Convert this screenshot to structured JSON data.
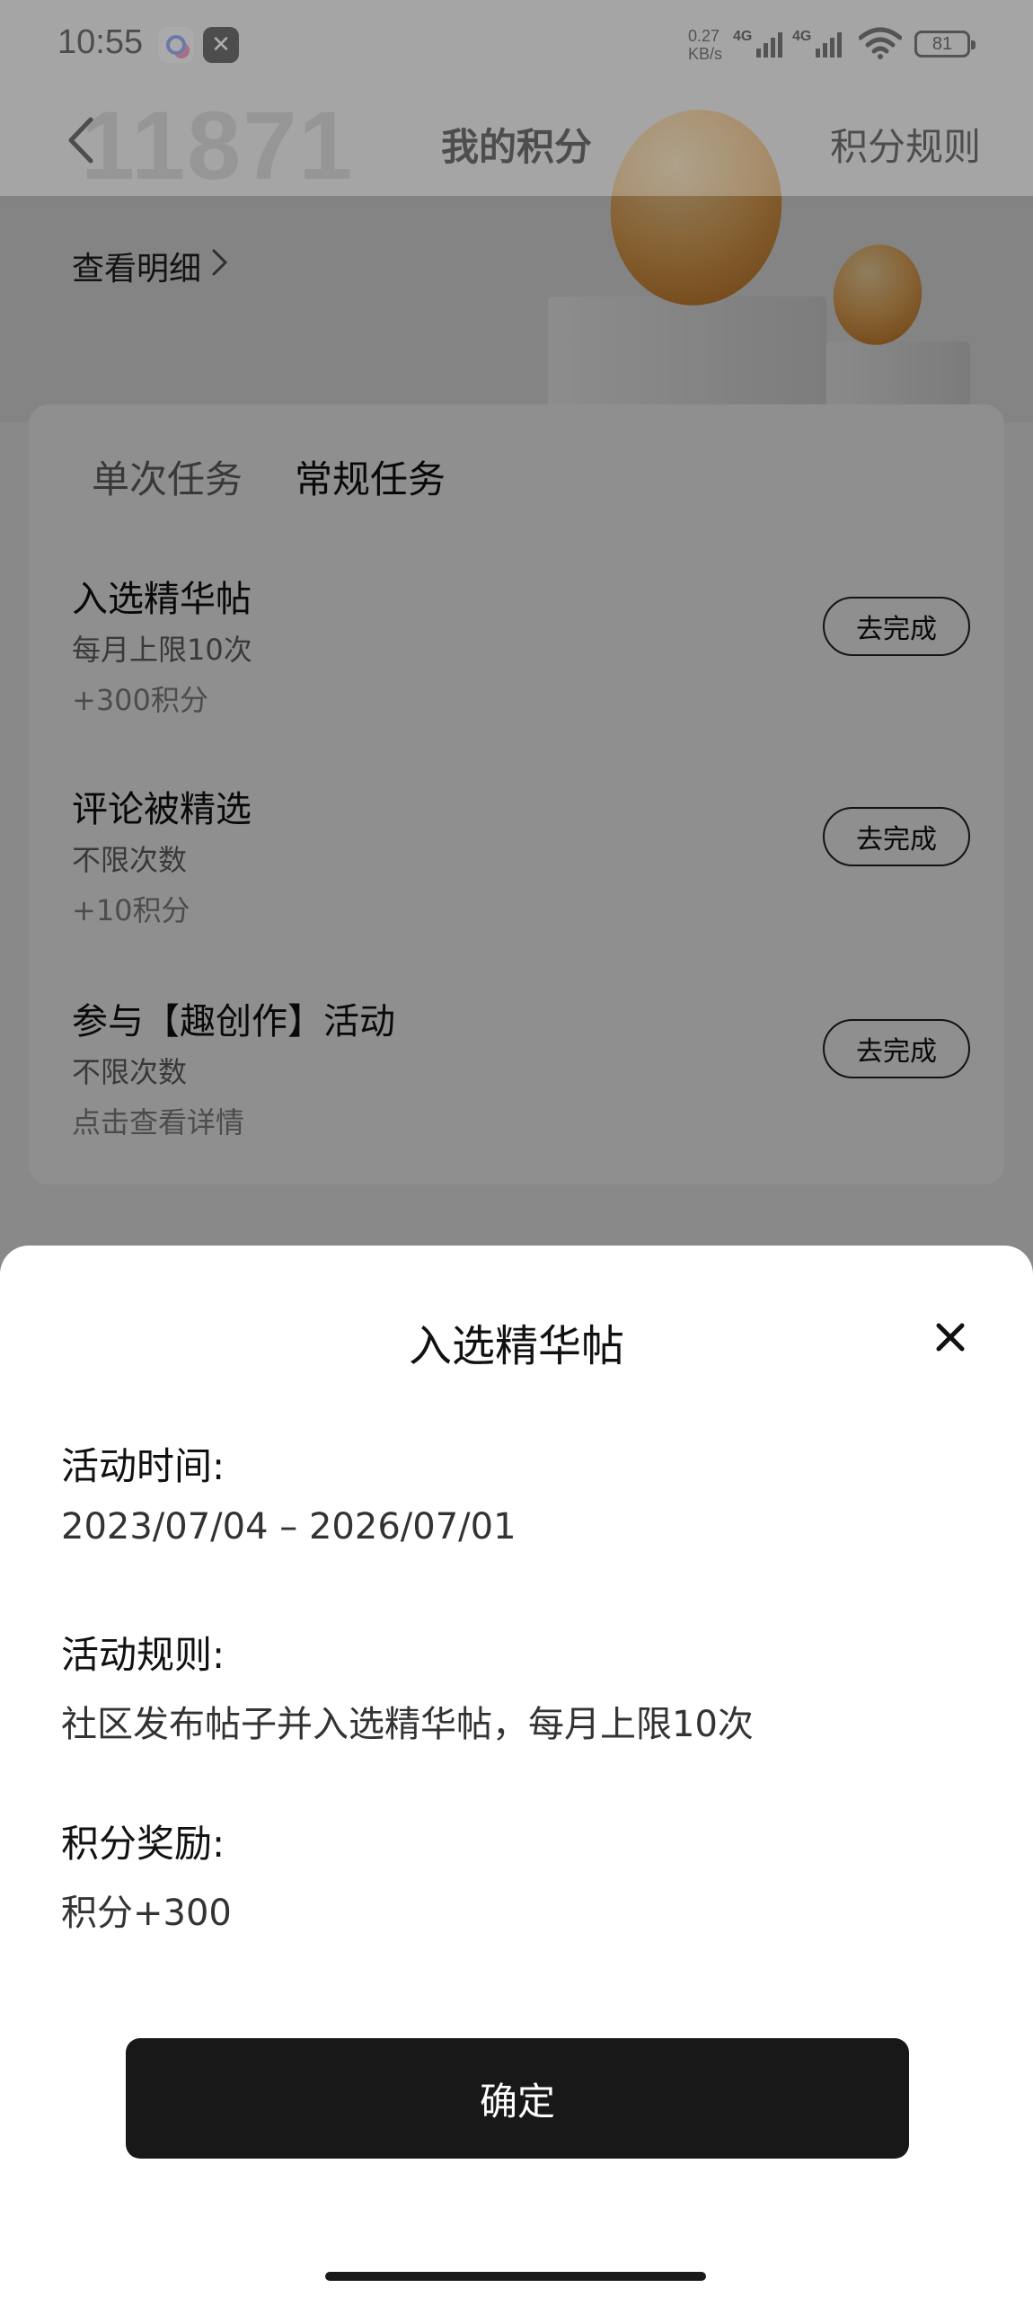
{
  "status_bar": {
    "time": "10:55",
    "net_speed_value": "0.27",
    "net_speed_unit": "KB/s",
    "signal_1_label": "4G",
    "signal_2_label": "4G",
    "battery": "81"
  },
  "nav": {
    "title": "我的积分",
    "rules_label": "积分规则"
  },
  "points": {
    "value": "11871",
    "detail_label": "查看明细"
  },
  "tabs": [
    {
      "label": "单次任务"
    },
    {
      "label": "常规任务"
    }
  ],
  "tasks": [
    {
      "title": "入选精华帖",
      "sub1": "每月上限10次",
      "sub2": "+300积分",
      "button": "去完成"
    },
    {
      "title": "评论被精选",
      "sub1": "不限次数",
      "sub2": "+10积分",
      "button": "去完成"
    },
    {
      "title": "参与【趣创作】活动",
      "sub1": "不限次数",
      "sub2": "点击查看详情",
      "button": "去完成"
    }
  ],
  "sheet": {
    "title": "入选精华帖",
    "time_label": "活动时间:",
    "time_value": "2023/07/04 – 2026/07/01",
    "rules_label": "活动规则:",
    "rules_value": "社区发布帖子并入选精华帖，每月上限10次",
    "reward_label": "积分奖励:",
    "reward_value": "积分+300",
    "confirm_label": "确定"
  },
  "icons": {
    "back": "back-icon",
    "close": "close-icon",
    "chevron": "chevron-right-icon",
    "wifi": "wifi-icon",
    "battery": "battery-icon"
  },
  "colors": {
    "confirm_bg": "#181818",
    "overlay": "rgba(0,0,0,0.44)",
    "coin": "#f1b260"
  }
}
